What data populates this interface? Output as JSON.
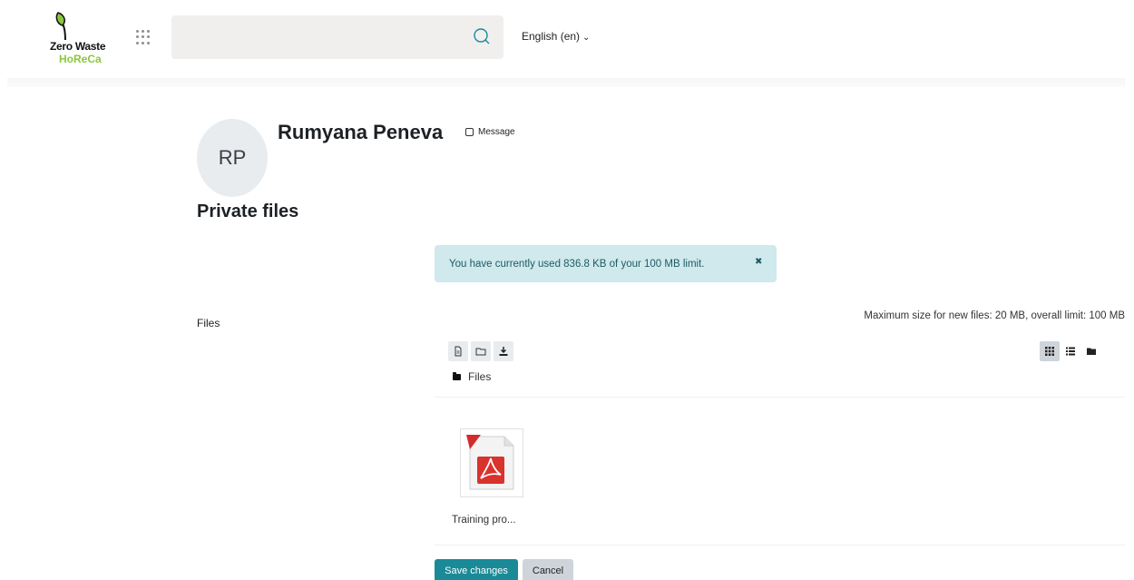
{
  "header": {
    "logo_line1": "Zero Waste",
    "logo_line2": "HoReCa",
    "search_placeholder": "",
    "language": "English (en)"
  },
  "profile": {
    "initials": "RP",
    "name": "Rumyana Peneva",
    "message_label": "Message"
  },
  "page": {
    "title": "Private files",
    "usage_alert": "You have currently used 836.8 KB of your 100 MB limit.",
    "files_label": "Files",
    "limit_text": "Maximum size for new files: 20 MB, overall limit: 100 MB"
  },
  "filemanager": {
    "path_label": "Files",
    "files": [
      {
        "name": "Training pro...",
        "icon": "pdf-icon"
      }
    ]
  },
  "buttons": {
    "save": "Save changes",
    "cancel": "Cancel"
  },
  "colors": {
    "primary": "#1a8a97",
    "alert_bg": "#cfe9ec",
    "logo_green": "#8cc63f"
  }
}
